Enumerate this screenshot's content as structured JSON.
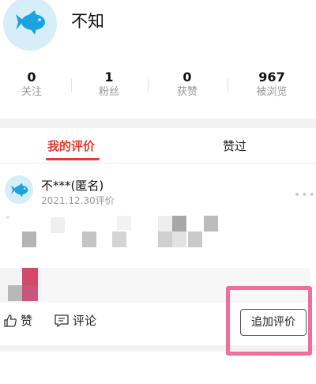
{
  "profile": {
    "username": "不知",
    "avatar_icon": "fish-icon",
    "stats": [
      {
        "value": "0",
        "label": "关注"
      },
      {
        "value": "1",
        "label": "粉丝"
      },
      {
        "value": "0",
        "label": "获赞"
      },
      {
        "value": "967",
        "label": "被浏览"
      }
    ]
  },
  "tabs": [
    {
      "label": "我的评价",
      "active": true
    },
    {
      "label": "赞过",
      "active": false
    }
  ],
  "review": {
    "reviewer": "不***(匿名)",
    "date": "2021.12.30评价",
    "actions": {
      "like_label": "赞",
      "comment_label": "评论",
      "add_review_label": "追加评价"
    }
  },
  "colors": {
    "accent": "#e43a2f",
    "highlight_frame": "#ef6f9a",
    "avatar_bg": "#d6eef8",
    "fish": "#1aa3e0"
  }
}
